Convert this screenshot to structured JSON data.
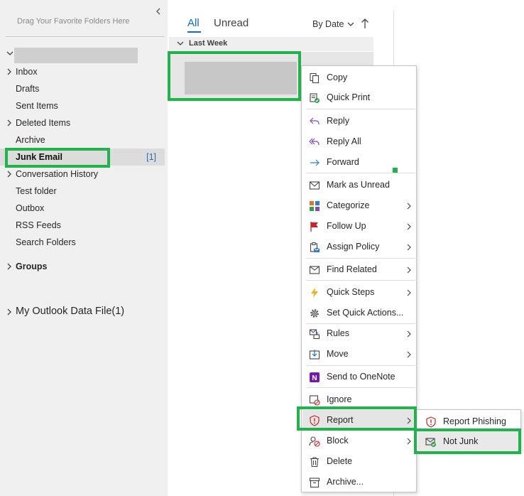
{
  "sidebar": {
    "favorites_hint": "Drag Your Favorite Folders Here",
    "folders": [
      {
        "label": "Inbox",
        "count": ""
      },
      {
        "label": "Drafts",
        "count": ""
      },
      {
        "label": "Sent Items",
        "count": ""
      },
      {
        "label": "Deleted Items",
        "count": ""
      },
      {
        "label": "Archive",
        "count": ""
      },
      {
        "label": "Junk Email",
        "count": "[1]"
      },
      {
        "label": "Conversation History",
        "count": ""
      },
      {
        "label": "Test folder",
        "count": ""
      },
      {
        "label": "Outbox",
        "count": ""
      },
      {
        "label": "RSS Feeds",
        "count": ""
      },
      {
        "label": "Search Folders",
        "count": ""
      },
      {
        "label": "Groups",
        "count": ""
      },
      {
        "label": "My Outlook Data File(1)",
        "count": ""
      }
    ]
  },
  "message_list": {
    "tabs": [
      "All",
      "Unread"
    ],
    "sort_label": "By Date",
    "group_header": "Last Week"
  },
  "context_menu": {
    "items": [
      {
        "label": "Copy",
        "icon": "copy-icon"
      },
      {
        "label": "Quick Print",
        "icon": "quick-print-icon"
      },
      {
        "label": "Reply",
        "icon": "reply-icon"
      },
      {
        "label": "Reply All",
        "icon": "reply-all-icon"
      },
      {
        "label": "Forward",
        "icon": "forward-icon"
      },
      {
        "label": "Mark as Unread",
        "icon": "envelope-icon"
      },
      {
        "label": "Categorize",
        "icon": "categorize-icon"
      },
      {
        "label": "Follow Up",
        "icon": "flag-icon"
      },
      {
        "label": "Assign Policy",
        "icon": "policy-icon"
      },
      {
        "label": "Find Related",
        "icon": "find-related-icon"
      },
      {
        "label": "Quick Steps",
        "icon": "lightning-icon"
      },
      {
        "label": "Set Quick Actions...",
        "icon": "gear-icon"
      },
      {
        "label": "Rules",
        "icon": "rules-icon"
      },
      {
        "label": "Move",
        "icon": "move-icon"
      },
      {
        "label": "Send to OneNote",
        "icon": "onenote-icon"
      },
      {
        "label": "Ignore",
        "icon": "ignore-icon"
      },
      {
        "label": "Report",
        "icon": "report-shield-icon"
      },
      {
        "label": "Block",
        "icon": "block-icon"
      },
      {
        "label": "Delete",
        "icon": "trash-icon"
      },
      {
        "label": "Archive...",
        "icon": "archive-icon"
      }
    ]
  },
  "report_submenu": {
    "items": [
      {
        "label": "Report Phishing",
        "icon": "phishing-shield-icon"
      },
      {
        "label": "Not Junk",
        "icon": "not-junk-icon"
      }
    ]
  },
  "colors": {
    "accent": "#0f6cbd",
    "annotation": "#22b14c",
    "report_red": "#c4262e"
  }
}
